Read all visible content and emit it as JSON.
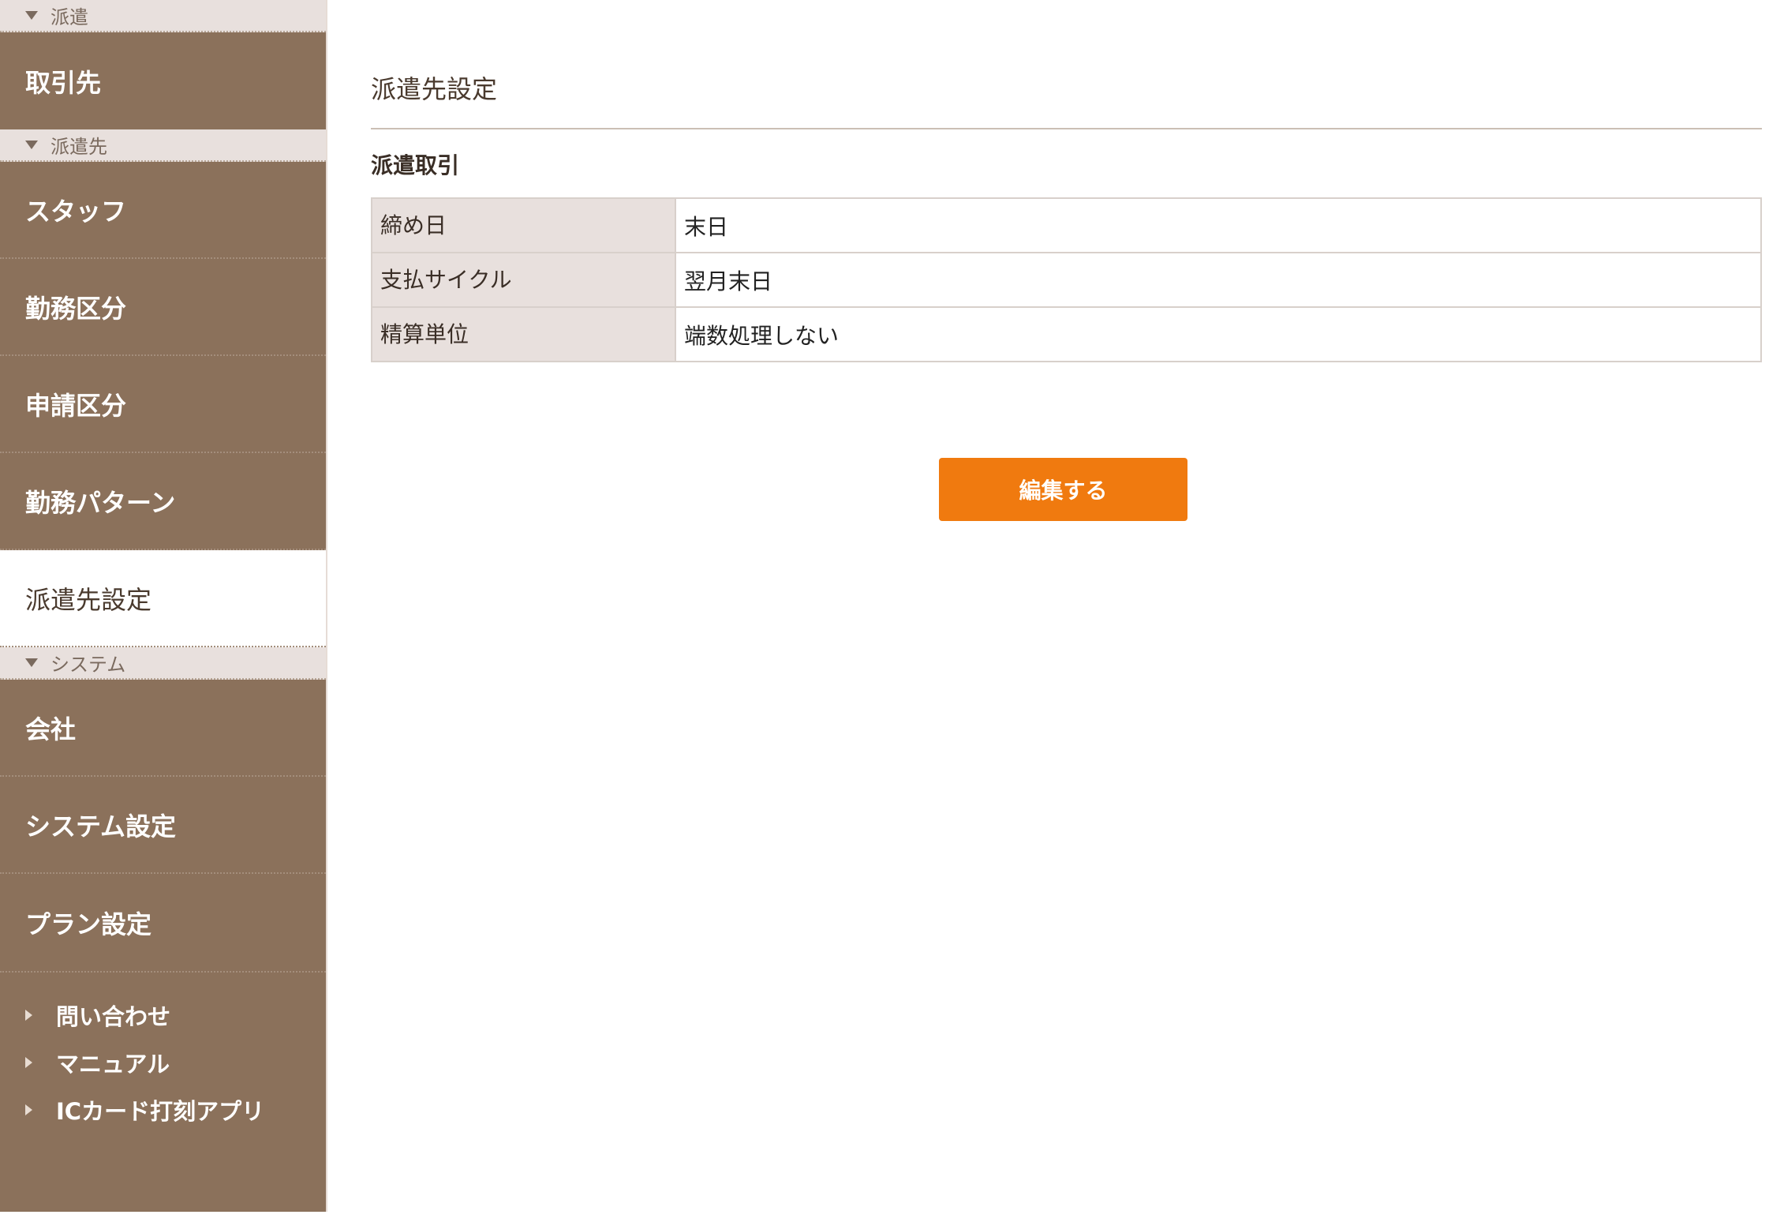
{
  "sidebar": {
    "sections": {
      "haken": "派遣",
      "hakensaki": "派遣先",
      "system": "システム"
    },
    "items": {
      "torihikisaki": "取引先",
      "staff": "スタッフ",
      "kinmu_kubun": "勤務区分",
      "shinsei_kubun": "申請区分",
      "kinmu_pattern": "勤務パターン",
      "hakensaki_settei": "派遣先設定",
      "kaisha": "会社",
      "system_settei": "システム設定",
      "plan_settei": "プラン設定"
    },
    "links": {
      "contact": "問い合わせ",
      "manual": "マニュアル",
      "ic_card_app": "ICカード打刻アプリ"
    },
    "active_item": "派遣先設定"
  },
  "main": {
    "title": "派遣先設定",
    "section_title": "派遣取引",
    "table": [
      {
        "label": "締め日",
        "value": "末日"
      },
      {
        "label": "支払サイクル",
        "value": "翌月末日"
      },
      {
        "label": "精算単位",
        "value": "端数処理しない"
      }
    ],
    "edit_button": "編集する"
  },
  "colors": {
    "sidebar_bg": "#8b715b",
    "section_header_bg": "#e8e0dd",
    "accent_button": "#f07a0f",
    "table_header_bg": "#e8e0dd"
  },
  "icons": {
    "section_toggle": "triangle-down-icon",
    "link_bullet": "triangle-right-icon"
  }
}
